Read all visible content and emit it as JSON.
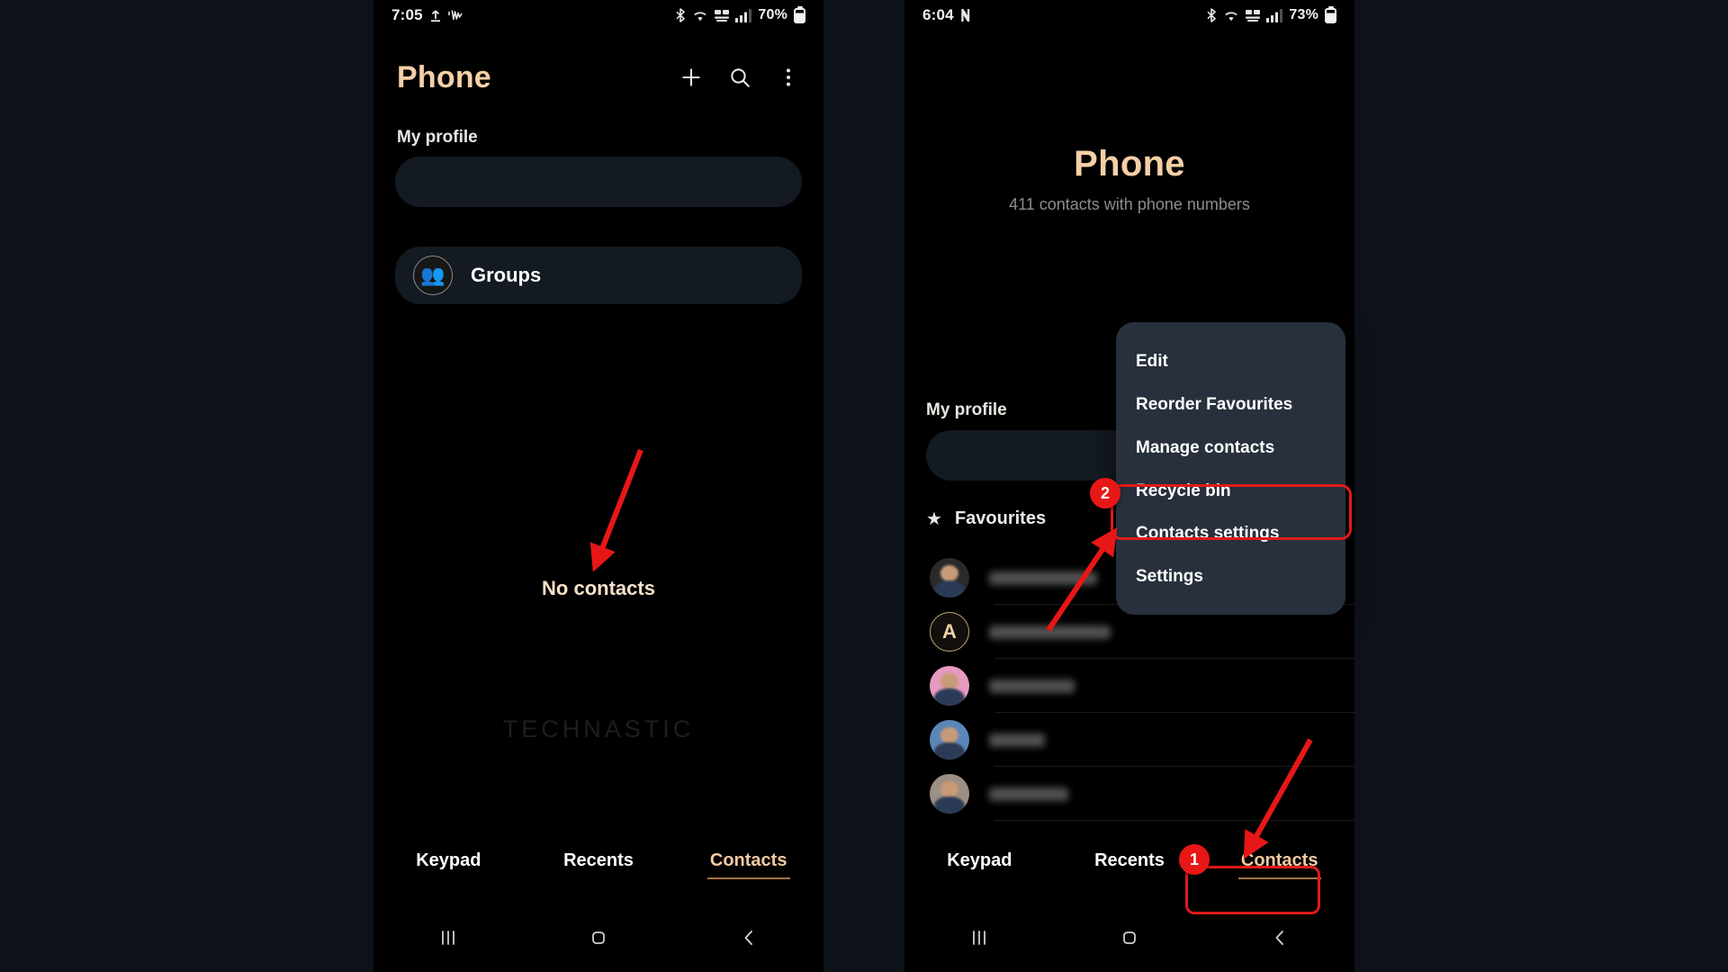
{
  "background_color": "#0d1219",
  "accent_color": "#f6cfa6",
  "highlight_color": "#e01a1a",
  "left_phone": {
    "status_bar": {
      "time": "7:05",
      "left_icons": [
        "upload-icon",
        "waveform-icon"
      ],
      "right_icons": [
        "bluetooth-icon",
        "wifi-icon",
        "vowifi-icon",
        "signal-icon"
      ],
      "battery": "70%"
    },
    "app_bar": {
      "title": "Phone",
      "actions": [
        "add-icon",
        "search-icon",
        "more-options-icon"
      ]
    },
    "my_profile_label": "My profile",
    "groups": {
      "label": "Groups",
      "icon": "groups-avatar-icon"
    },
    "empty_state": "No contacts",
    "watermark": "TECHNASTIC",
    "tabs": [
      {
        "label": "Keypad",
        "active": false
      },
      {
        "label": "Recents",
        "active": false
      },
      {
        "label": "Contacts",
        "active": true
      }
    ],
    "nav_buttons": [
      "recents-nav-icon",
      "home-nav-icon",
      "back-nav-icon"
    ]
  },
  "right_phone": {
    "status_bar": {
      "time": "6:04",
      "left_icons": [
        "nfc-icon"
      ],
      "right_icons": [
        "bluetooth-icon",
        "wifi-icon",
        "vowifi-icon",
        "signal-icon"
      ],
      "battery": "73%"
    },
    "hero": {
      "title": "Phone",
      "subtitle": "411 contacts with phone numbers"
    },
    "my_profile_label": "My profile",
    "favourites": {
      "label": "Favourites",
      "icon": "star-icon"
    },
    "contacts": [
      {
        "avatar_type": "photo",
        "avatar_letter": "",
        "name_redacted": true,
        "name_width": 120
      },
      {
        "avatar_type": "letter",
        "avatar_letter": "A",
        "name_redacted": true,
        "name_width": 135
      },
      {
        "avatar_type": "photo",
        "avatar_letter": "",
        "name_redacted": true,
        "name_width": 95
      },
      {
        "avatar_type": "photo",
        "avatar_letter": "",
        "name_redacted": true,
        "name_width": 62
      },
      {
        "avatar_type": "photo",
        "avatar_letter": "",
        "name_redacted": true,
        "name_width": 88
      }
    ],
    "popup_menu": {
      "items": [
        {
          "label": "Edit",
          "highlighted": false
        },
        {
          "label": "Reorder Favourites",
          "highlighted": false
        },
        {
          "label": "Manage contacts",
          "highlighted": false
        },
        {
          "label": "Recycle bin",
          "highlighted": true
        },
        {
          "label": "Contacts settings",
          "highlighted": false
        },
        {
          "label": "Settings",
          "highlighted": false
        }
      ]
    },
    "tabs": [
      {
        "label": "Keypad",
        "active": false
      },
      {
        "label": "Recents",
        "active": false
      },
      {
        "label": "Contacts",
        "active": true
      }
    ],
    "nav_buttons": [
      "recents-nav-icon",
      "home-nav-icon",
      "back-nav-icon"
    ]
  },
  "annotations": {
    "step_badges": [
      {
        "number": "1",
        "target": "contacts-tab"
      },
      {
        "number": "2",
        "target": "recycle-bin-menu-item"
      }
    ],
    "arrows": [
      {
        "name": "arrow-to-no-contacts"
      },
      {
        "name": "arrow-to-recycle-bin"
      },
      {
        "name": "arrow-to-contacts-tab"
      }
    ]
  }
}
